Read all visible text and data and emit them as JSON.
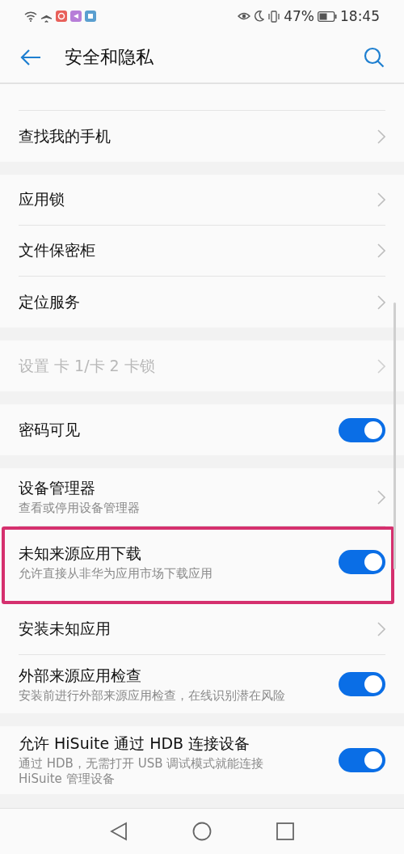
{
  "status_bar": {
    "battery": "47%",
    "time": "18:45"
  },
  "header": {
    "title": "安全和隐私"
  },
  "groups": [
    {
      "rows": [
        {
          "kind": "link",
          "title": "查找我的手机",
          "disabled": false,
          "highlighted": false
        }
      ]
    },
    {
      "rows": [
        {
          "kind": "link",
          "title": "应用锁",
          "disabled": false,
          "highlighted": false
        },
        {
          "kind": "link",
          "title": "文件保密柜",
          "disabled": false,
          "highlighted": false
        },
        {
          "kind": "link",
          "title": "定位服务",
          "disabled": false,
          "highlighted": false
        }
      ]
    },
    {
      "rows": [
        {
          "kind": "link",
          "title": "设置 卡 1/卡 2 卡锁",
          "disabled": true,
          "highlighted": false
        }
      ]
    },
    {
      "rows": [
        {
          "kind": "switch",
          "title": "密码可见",
          "on": true,
          "disabled": false,
          "highlighted": false
        }
      ]
    },
    {
      "rows": [
        {
          "kind": "link",
          "title": "设备管理器",
          "subtitle": "查看或停用设备管理器",
          "disabled": false,
          "highlighted": false
        },
        {
          "kind": "switch",
          "title": "未知来源应用下载",
          "subtitle": "允许直接从非华为应用市场下载应用",
          "on": true,
          "disabled": false,
          "highlighted": true
        },
        {
          "kind": "link",
          "title": "安装未知应用",
          "disabled": false,
          "highlighted": false
        },
        {
          "kind": "switch",
          "title": "外部来源应用检查",
          "subtitle": "安装前进行外部来源应用检查，在线识别潜在风险",
          "on": true,
          "disabled": false,
          "highlighted": false
        }
      ]
    },
    {
      "rows": [
        {
          "kind": "switch",
          "title": "允许 HiSuite 通过 HDB 连接设备",
          "subtitle": "通过 HDB，无需打开 USB 调试模式就能连接 HiSuite 管理设备",
          "on": true,
          "disabled": false,
          "highlighted": false
        }
      ]
    }
  ]
}
